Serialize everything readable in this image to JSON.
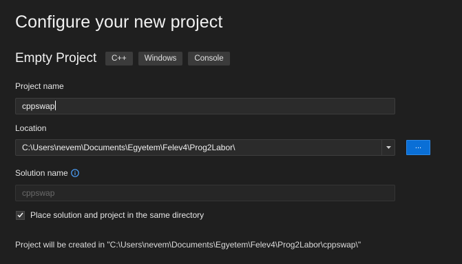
{
  "dialog": {
    "title": "Configure your new project",
    "template_name": "Empty Project",
    "tags": [
      "C++",
      "Windows",
      "Console"
    ]
  },
  "project_name": {
    "label": "Project name",
    "value": "cppswap"
  },
  "location": {
    "label": "Location",
    "value": "C:\\Users\\nevem\\Documents\\Egyetem\\Felev4\\Prog2Labor\\",
    "browse_label": "..."
  },
  "solution_name": {
    "label": "Solution name",
    "value": "cppswap",
    "info_icon": "info-icon"
  },
  "same_directory": {
    "label": "Place solution and project in the same directory",
    "checked": true
  },
  "note": "Project will be created in \"C:\\Users\\nevem\\Documents\\Egyetem\\Felev4\\Prog2Labor\\cppswap\\\"",
  "colors": {
    "background": "#1f1f1f",
    "accent": "#0a6fd6",
    "info": "#4da3ff"
  }
}
